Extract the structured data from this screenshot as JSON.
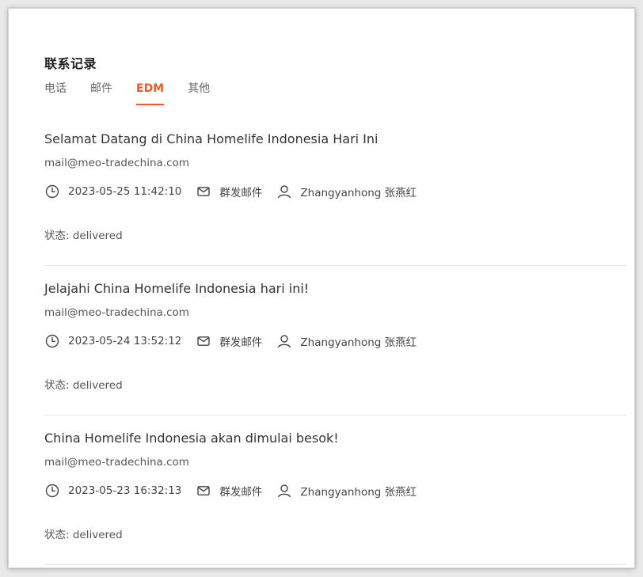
{
  "header": {
    "title": "联系记录"
  },
  "tabs": [
    {
      "label": "电话",
      "active": false
    },
    {
      "label": "邮件",
      "active": false
    },
    {
      "label": "EDM",
      "active": true
    },
    {
      "label": "其他",
      "active": false
    }
  ],
  "records": [
    {
      "title": "Selamat Datang di China Homelife Indonesia Hari Ini",
      "email": "mail@meo-tradechina.com",
      "datetime": "2023-05-25 11:42:10",
      "type": "群发邮件",
      "user": "Zhangyanhong 张燕红",
      "status_label": "状态:",
      "status_value": "delivered"
    },
    {
      "title": "Jelajahi China Homelife Indonesia hari ini!",
      "email": "mail@meo-tradechina.com",
      "datetime": "2023-05-24 13:52:12",
      "type": "群发邮件",
      "user": "Zhangyanhong 张燕红",
      "status_label": "状态:",
      "status_value": "delivered"
    },
    {
      "title": "China Homelife Indonesia akan dimulai besok!",
      "email": "mail@meo-tradechina.com",
      "datetime": "2023-05-23 16:32:13",
      "type": "群发邮件",
      "user": "Zhangyanhong 张燕红",
      "status_label": "状态:",
      "status_value": "delivered"
    }
  ],
  "icons": {
    "time": "clock-icon",
    "type": "envelope-icon",
    "user": "user-icon"
  },
  "colors": {
    "accent": "#f05a24",
    "text": "#333333",
    "muted": "#666666"
  }
}
